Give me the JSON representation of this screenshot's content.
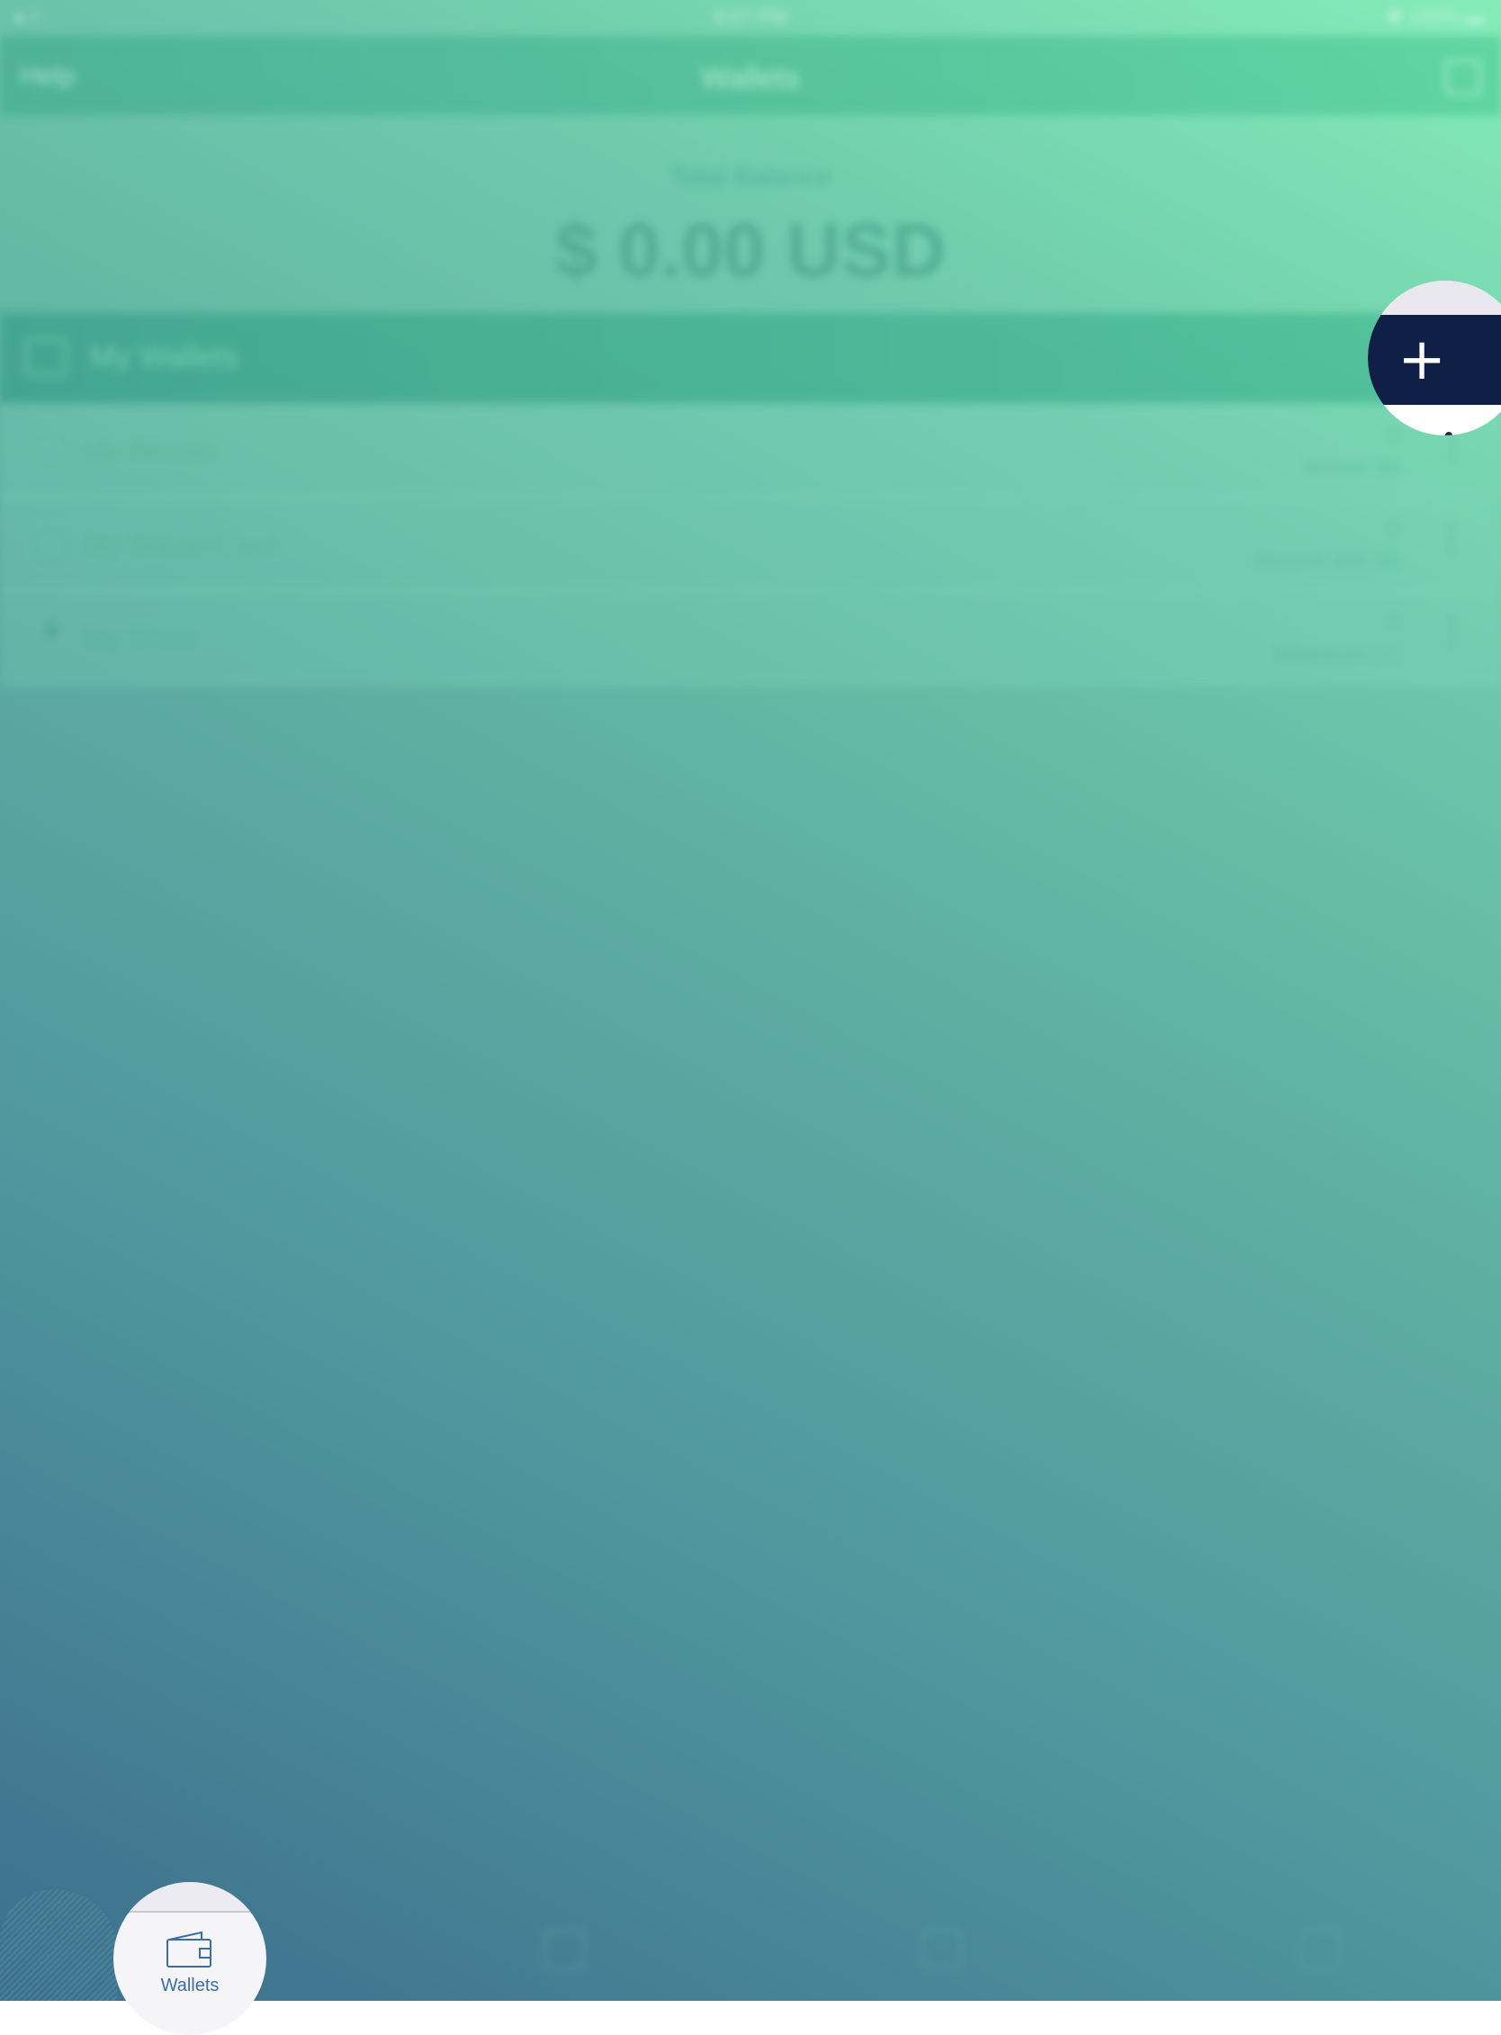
{
  "status_bar": {
    "time": "8:07 PM",
    "battery": "100%"
  },
  "nav": {
    "left": "Help",
    "title": "Wallets"
  },
  "balance": {
    "label": "Total Balance",
    "amount": "$ 0.00 USD"
  },
  "wallets_section": {
    "label": "My Wallets"
  },
  "wallets": [
    {
      "name": "My Bitcoin",
      "count": "0",
      "unit": "Bitcoin (b)"
    },
    {
      "name": "My BitcoinCash",
      "count": "0",
      "unit": "BitcoinCash (b)"
    },
    {
      "name": "My Ether",
      "count": "0",
      "unit": "Ethereum (Ξ)"
    }
  ],
  "tabs": {
    "wallets_label": "Wallets"
  },
  "colors": {
    "add_button_bg": "#0f1f45",
    "tab_active": "#3b6da9"
  }
}
